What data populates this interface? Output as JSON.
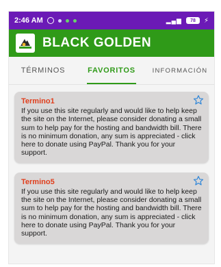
{
  "status": {
    "time": "2:46 AM",
    "battery": "78"
  },
  "app": {
    "title": "BLACK GOLDEN"
  },
  "tabs": [
    {
      "label": "TÉRMINOS"
    },
    {
      "label": "FAVORITOS"
    },
    {
      "label": "INFORMACIÓN"
    }
  ],
  "cards": [
    {
      "title": "Termino1",
      "body": "If you use this site regularly and would like to help keep the site on the Internet, please consider donating a small sum to help pay for the hosting and bandwidth bill. There is no minimum donation, any sum is appreciated - click here to donate using PayPal. Thank you for your support."
    },
    {
      "title": "Termino5",
      "body": "If you use this site regularly and would like to help keep the site on the Internet, please consider donating a small sum to help pay for the hosting and bandwidth bill. There is no minimum donation, any sum is appreciated - click here to donate using PayPal. Thank you for your support."
    }
  ],
  "colors": {
    "status_bar": "#6b1ab6",
    "app_bar": "#2f9a18",
    "active_tab": "#2f9a18",
    "card_title": "#e03e1c",
    "star": "#2f86d8"
  }
}
